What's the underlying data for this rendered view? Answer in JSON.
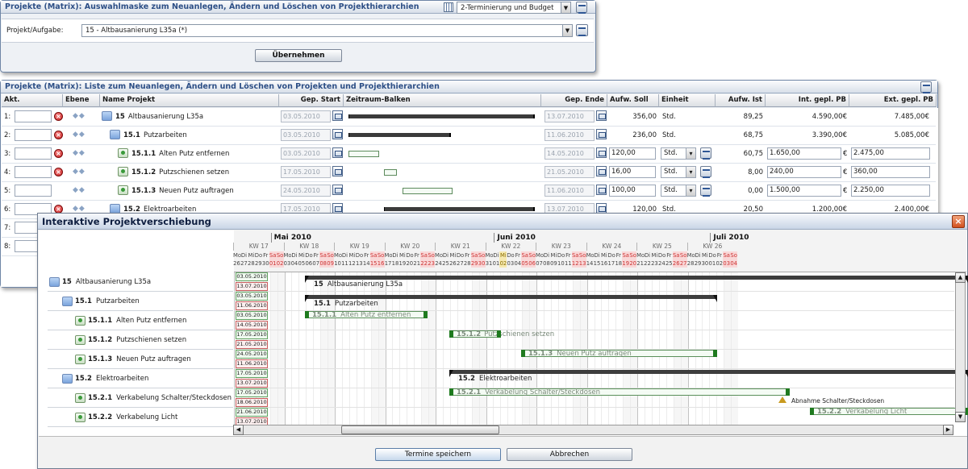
{
  "top_panel": {
    "title": "Projekte (Matrix): Auswahlmaske zum Neuanlegen, Ändern und Löschen von Projekthierarchien",
    "view_select": "2-Terminierung und Budget",
    "field_label": "Projekt/Aufgabe:",
    "field_value": "15 - Altbausanierung L35a (*)",
    "apply_button": "Übernehmen"
  },
  "list_panel": {
    "title": "Projekte (Matrix): Liste zum Neuanlegen, Ändern und Löschen von Projekten und Projekthierarchien",
    "columns": {
      "akt": "Akt.",
      "ebene": "Ebene",
      "name": "Name Projekt",
      "gep_start": "Gep. Start",
      "zeitraum": "Zeitraum-Balken",
      "gep_ende": "Gep. Ende",
      "aufw_soll": "Aufw. Soll",
      "einheit": "Einheit",
      "aufw_ist": "Aufw. Ist",
      "int_pb": "Int. gepl. PB",
      "ext_pb": "Ext. gepl. PB"
    },
    "rows": [
      {
        "idx": "1:",
        "id": "15",
        "name": "Altbausanierung L35a",
        "start": "03.05.2010",
        "end": "13.07.2010",
        "soll": "356,00",
        "unit": "Std.",
        "ist": "89,25",
        "int": "4.590,00€",
        "ext": "7.485,00€"
      },
      {
        "idx": "2:",
        "id": "15.1",
        "name": "Putzarbeiten",
        "start": "03.05.2010",
        "end": "11.06.2010",
        "soll": "236,00",
        "unit": "Std.",
        "ist": "68,75",
        "int": "3.390,00€",
        "ext": "5.085,00€"
      },
      {
        "idx": "3:",
        "id": "15.1.1",
        "name": "Alten Putz entfernen",
        "start": "03.05.2010",
        "end": "14.05.2010",
        "soll": "120,00",
        "unit": "Std.",
        "ist": "60,75",
        "int": "1.650,00",
        "ext": "2.475,00"
      },
      {
        "idx": "4:",
        "id": "15.1.2",
        "name": "Putzschienen setzen",
        "start": "17.05.2010",
        "end": "21.05.2010",
        "soll": "16,00",
        "unit": "Std.",
        "ist": "8,00",
        "int": "240,00",
        "ext": "360,00"
      },
      {
        "idx": "5:",
        "id": "15.1.3",
        "name": "Neuen Putz auftragen",
        "start": "24.05.2010",
        "end": "11.06.2010",
        "soll": "100,00",
        "unit": "Std.",
        "ist": "0,00",
        "int": "1.500,00",
        "ext": "2.250,00"
      },
      {
        "idx": "6:",
        "id": "15.2",
        "name": "Elektroarbeiten",
        "start": "17.05.2010",
        "end": "13.07.2010",
        "soll": "120,00",
        "unit": "Std.",
        "ist": "20,50",
        "int": "1.200,00€",
        "ext": "2.400,00€"
      }
    ],
    "extra_idx": [
      "7:",
      "8:"
    ],
    "currency": "€"
  },
  "dialog": {
    "title": "Interaktive Projektverschiebung",
    "months": [
      "Mai 2010",
      "Juni 2010",
      "Juli 2010"
    ],
    "weeks": [
      "KW 17",
      "KW 18",
      "KW 19",
      "KW 20",
      "KW 21",
      "KW 22",
      "KW 23",
      "KW 24",
      "KW 25",
      "KW 26"
    ],
    "day_names": [
      "Mo",
      "Di",
      "Mi",
      "Do",
      "Fr",
      "Sa",
      "So"
    ],
    "days": [
      "26",
      "27",
      "28",
      "29",
      "30",
      "01",
      "02",
      "03",
      "04",
      "05",
      "06",
      "07",
      "08",
      "09",
      "10",
      "11",
      "12",
      "13",
      "14",
      "15",
      "16",
      "17",
      "18",
      "19",
      "20",
      "21",
      "22",
      "23",
      "24",
      "25",
      "26",
      "27",
      "28",
      "29",
      "30",
      "31",
      "01",
      "02",
      "03",
      "04",
      "05",
      "06",
      "07",
      "08",
      "09",
      "10",
      "11",
      "12",
      "13",
      "14",
      "15",
      "16",
      "17",
      "18",
      "19",
      "20",
      "21",
      "22",
      "23",
      "24",
      "25",
      "26",
      "27",
      "28",
      "29",
      "30",
      "01",
      "02",
      "03",
      "04"
    ],
    "tree": [
      {
        "id": "15",
        "name": "Altbausanierung L35a",
        "start": "03.05.2010",
        "end": "13.07.2010"
      },
      {
        "id": "15.1",
        "name": "Putzarbeiten",
        "start": "03.05.2010",
        "end": "11.06.2010"
      },
      {
        "id": "15.1.1",
        "name": "Alten Putz entfernen",
        "start": "03.05.2010",
        "end": "14.05.2010"
      },
      {
        "id": "15.1.2",
        "name": "Putzschienen setzen",
        "start": "17.05.2010",
        "end": "21.05.2010"
      },
      {
        "id": "15.1.3",
        "name": "Neuen Putz auftragen",
        "start": "24.05.2010",
        "end": "11.06.2010"
      },
      {
        "id": "15.2",
        "name": "Elektroarbeiten",
        "start": "17.05.2010",
        "end": "13.07.2010"
      },
      {
        "id": "15.2.1",
        "name": "Verkabelung Schalter/Steckdosen",
        "start": "17.05.2010",
        "end": "18.06.2010"
      },
      {
        "id": "15.2.2",
        "name": "Verkabelung Licht",
        "start": "21.06.2010",
        "end": "13.07.2010"
      }
    ],
    "milestone_label": "Abnahme Schalter/Steckdosen",
    "save_button": "Termine speichern",
    "cancel_button": "Abbrechen"
  }
}
